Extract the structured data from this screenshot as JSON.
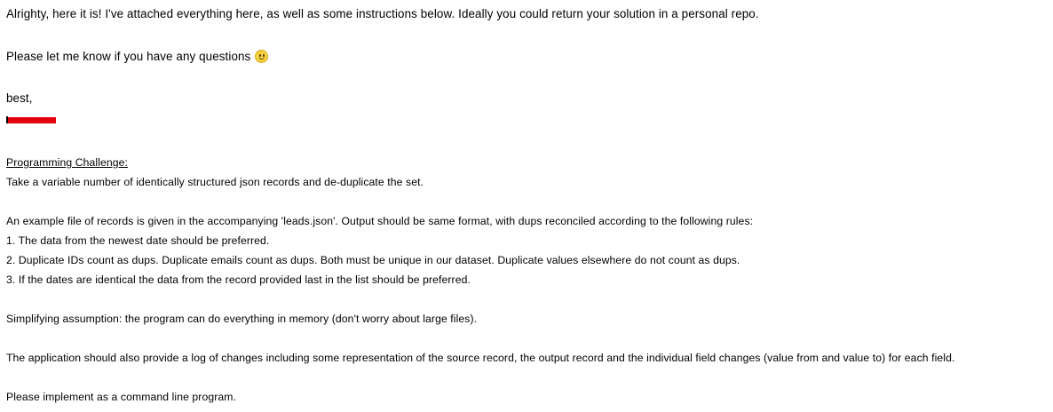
{
  "email": {
    "intro": "Alrighty, here it is! I've attached everything here, as well as some instructions below. Ideally you could return your solution in a personal repo.",
    "questions": "Please let me know if you have any questions",
    "questions_emoji": "smiley-face-icon",
    "signoff": "best,",
    "signature_redacted_color": "#e3000f",
    "challenge_heading": "Programming Challenge:",
    "challenge_summary": "Take a variable number of identically structured json records and de-duplicate the set.",
    "example_line": "An example file of records is given in the accompanying 'leads.json'.  Output should be same format, with dups reconciled according to the following rules:",
    "rules": [
      "1. The data from the newest date should be preferred.",
      "2. Duplicate IDs count as dups. Duplicate emails count as dups. Both must be unique in our dataset. Duplicate values elsewhere do not count as dups.",
      "3. If the dates are identical the data from the record provided last in the list should be preferred."
    ],
    "assumption": "Simplifying assumption: the program can do everything in memory (don't worry about large files).",
    "log_requirement": "The application should also provide a log of changes including some representation of the source record, the output record and the individual field changes (value from and value to) for each field.",
    "implementation": "Please implement as a command line program."
  }
}
